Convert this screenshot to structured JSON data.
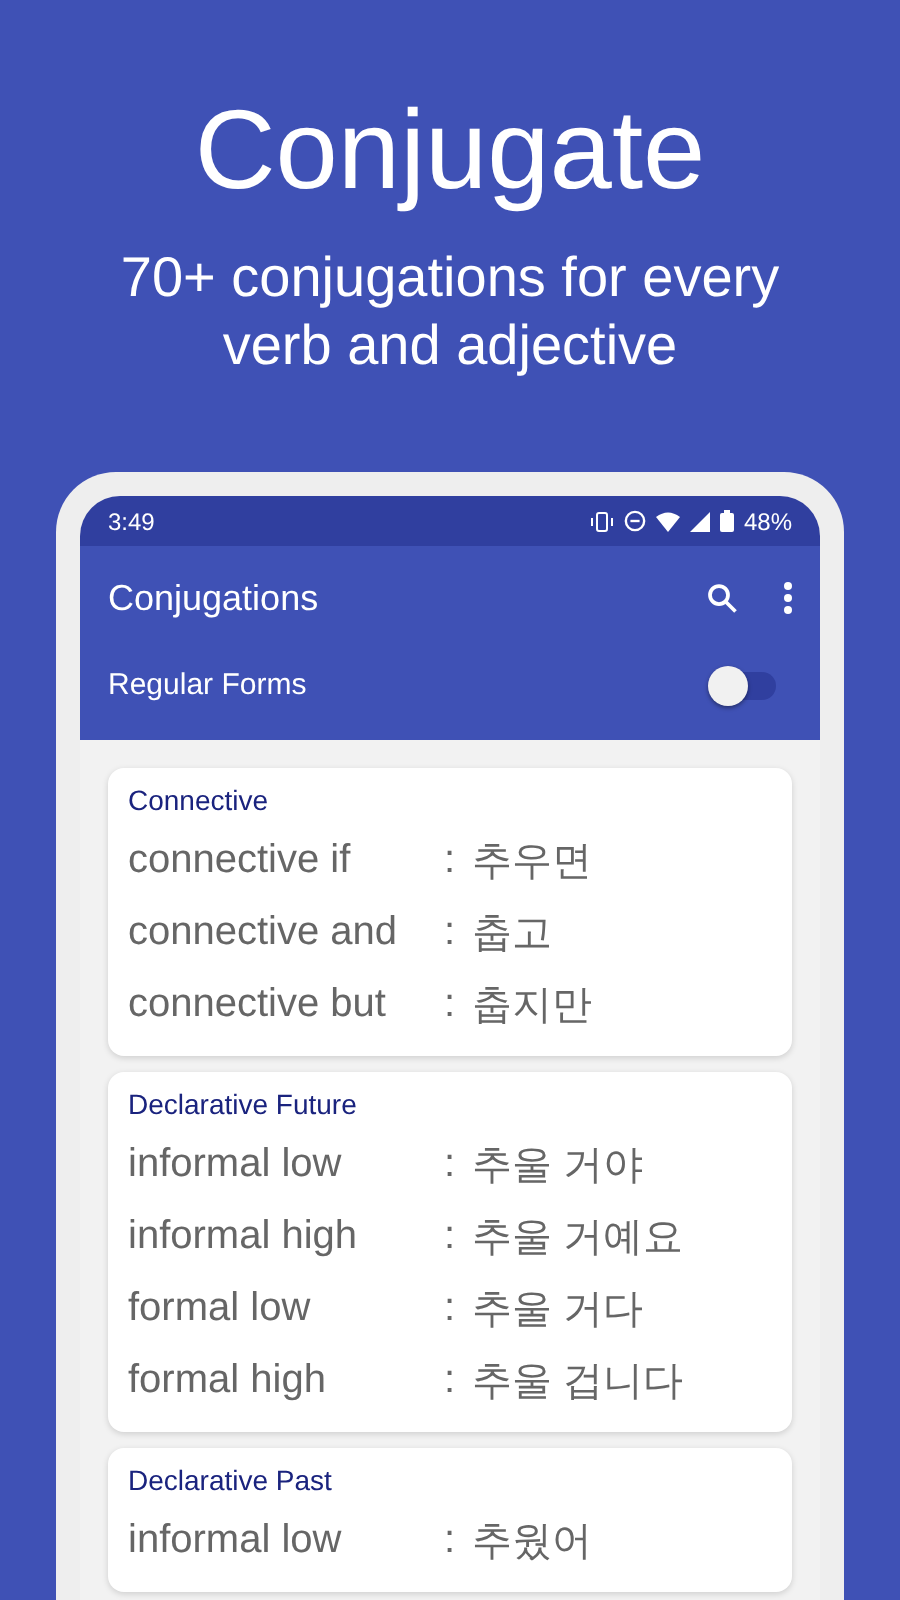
{
  "headline": "Conjugate",
  "subtitle": "70+ conjugations for every verb and adjective",
  "status_bar": {
    "time": "3:49",
    "battery": "48%"
  },
  "app_bar": {
    "title": "Conjugations"
  },
  "regular_forms": {
    "label": "Regular Forms",
    "on": false
  },
  "sections": [
    {
      "title": "Connective",
      "rows": [
        {
          "label": "connective if",
          "sep": ":",
          "value": "추우면"
        },
        {
          "label": "connective and",
          "sep": ":",
          "value": "춥고"
        },
        {
          "label": "connective but",
          "sep": ":",
          "value": "춥지만"
        }
      ]
    },
    {
      "title": "Declarative Future",
      "rows": [
        {
          "label": "informal low",
          "sep": ":",
          "value": "추울 거야"
        },
        {
          "label": "informal high",
          "sep": ":",
          "value": "추울 거예요"
        },
        {
          "label": "formal low",
          "sep": ":",
          "value": "추울 거다"
        },
        {
          "label": "formal high",
          "sep": ":",
          "value": "추울 겁니다"
        }
      ]
    },
    {
      "title": "Declarative Past",
      "rows": [
        {
          "label": "informal low",
          "sep": ":",
          "value": "추웠어"
        }
      ]
    }
  ]
}
